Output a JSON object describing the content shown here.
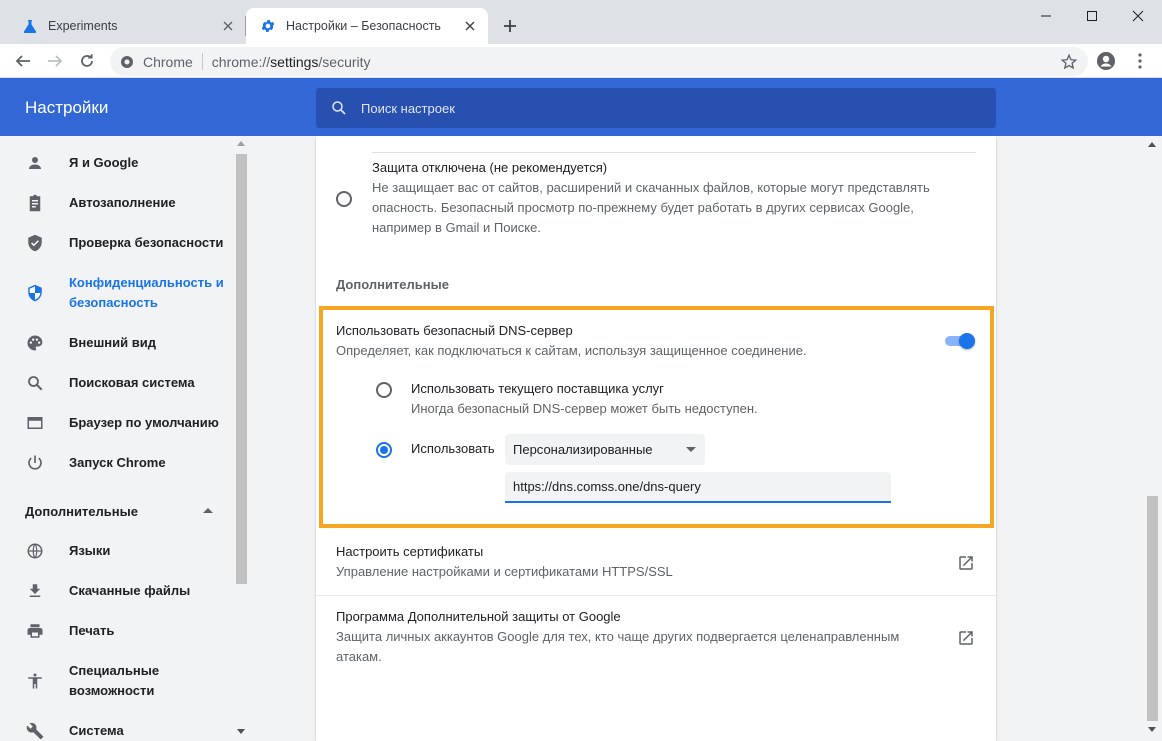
{
  "tabs": [
    {
      "title": "Experiments",
      "active": false
    },
    {
      "title": "Настройки – Безопасность",
      "active": true
    }
  ],
  "omnibox": {
    "scheme": "Chrome",
    "url_prefix": "chrome://",
    "url_host": "settings",
    "url_path": "/security"
  },
  "header": {
    "title": "Настройки",
    "search_placeholder": "Поиск настроек"
  },
  "sidebar": {
    "items": [
      {
        "label": "Я и Google",
        "icon": "person-icon"
      },
      {
        "label": "Автозаполнение",
        "icon": "clipboard-icon"
      },
      {
        "label": "Проверка безопасности",
        "icon": "shield-check-icon"
      },
      {
        "label": "Конфиденциальность и безопасность",
        "icon": "shield-icon",
        "selected": true
      },
      {
        "label": "Внешний вид",
        "icon": "palette-icon"
      },
      {
        "label": "Поисковая система",
        "icon": "search-icon"
      },
      {
        "label": "Браузер по умолчанию",
        "icon": "browser-icon"
      },
      {
        "label": "Запуск Chrome",
        "icon": "power-icon"
      }
    ],
    "advanced_label": "Дополнительные",
    "advanced_items": [
      {
        "label": "Языки",
        "icon": "globe-icon"
      },
      {
        "label": "Скачанные файлы",
        "icon": "download-icon"
      },
      {
        "label": "Печать",
        "icon": "print-icon"
      },
      {
        "label": "Специальные возможности",
        "icon": "accessibility-icon"
      },
      {
        "label": "Система",
        "icon": "wrench-icon"
      }
    ]
  },
  "main": {
    "protection_off": {
      "title": "Защита отключена (не рекомендуется)",
      "desc_line1": "Не защищает вас от сайтов, расширений и скачанных файлов, которые могут представлять",
      "desc_line2": "опасность. Безопасный просмотр по-прежнему будет работать в других сервисах Google,",
      "desc_line3": "например в Gmail и Поиске."
    },
    "advanced_label": "Дополнительные",
    "secure_dns": {
      "title": "Использовать безопасный DNS-сервер",
      "desc": "Определяет, как подключаться к сайтам, используя защищенное соединение.",
      "enabled": true,
      "option_current_title": "Использовать текущего поставщика услуг",
      "option_current_desc": "Иногда безопасный DNS-сервер может быть недоступен.",
      "option_custom_label": "Использовать",
      "provider_selected": "Персонализированные",
      "custom_url": "https://dns.comss.one/dns-query"
    },
    "certificates": {
      "title": "Настроить сертификаты",
      "desc": "Управление настройками и сертификатами HTTPS/SSL"
    },
    "advanced_protection": {
      "title": "Программа Дополнительной защиты от Google",
      "desc_line1": "Защита личных аккаунтов Google для тех, кто чаще других подвергается целенаправленным",
      "desc_line2": "атакам."
    }
  },
  "colors": {
    "header": "#3367d6",
    "accent": "#1a73e8",
    "highlight": "#f5a623"
  }
}
